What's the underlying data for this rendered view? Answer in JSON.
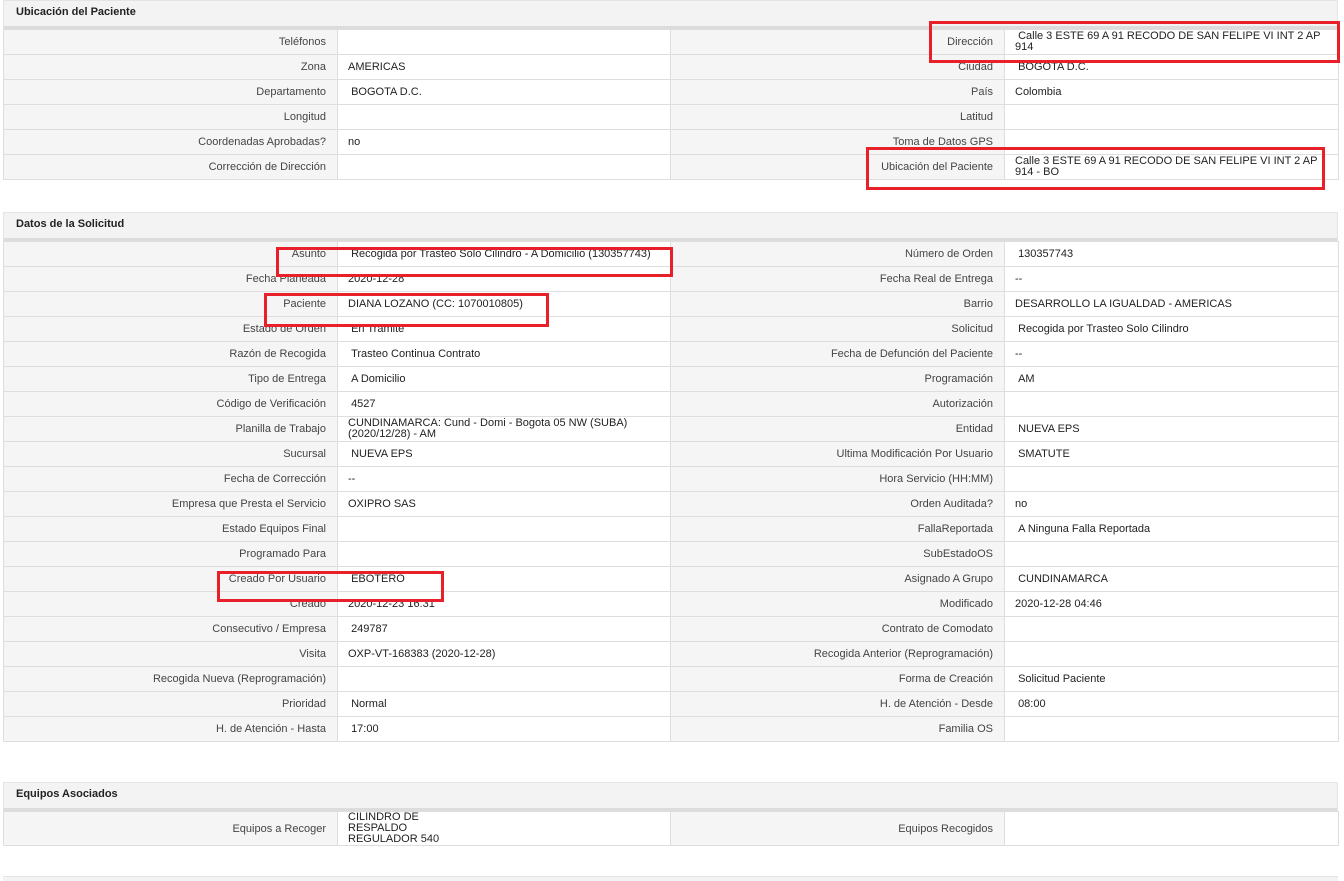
{
  "ubicacion": {
    "title": "Ubicación del Paciente",
    "rows": [
      {
        "l1": "Teléfonos",
        "v1": "",
        "l2": "Dirección",
        "v2": " Calle 3 ESTE 69 A 91 RECODO DE SAN FELIPE VI INT 2 AP 914"
      },
      {
        "l1": "Zona",
        "v1": "AMERICAS",
        "l2": "Ciudad",
        "v2": " BOGOTA D.C."
      },
      {
        "l1": "Departamento",
        "v1": " BOGOTA D.C.",
        "l2": "País",
        "v2": "Colombia"
      },
      {
        "l1": "Longitud",
        "v1": "",
        "l2": "Latitud",
        "v2": ""
      },
      {
        "l1": "Coordenadas Aprobadas?",
        "v1": "no",
        "l2": "Toma de Datos GPS",
        "v2": ""
      },
      {
        "l1": "Corrección de Dirección",
        "v1": "",
        "l2": "Ubicación del Paciente",
        "v2": "Calle 3 ESTE 69 A 91 RECODO DE SAN FELIPE VI INT 2 AP 914 - BO"
      }
    ]
  },
  "solicitud": {
    "title": "Datos de la Solicitud",
    "rows": [
      {
        "l1": "Asunto",
        "v1": " Recogida por Trasteo Solo Cilindro - A Domicilio (130357743)",
        "l2": "Número de Orden",
        "v2": " 130357743"
      },
      {
        "l1": "Fecha Planeada",
        "v1": "2020-12-28",
        "l2": "Fecha Real de Entrega",
        "v2": "--"
      },
      {
        "l1": "Paciente",
        "v1": "DIANA LOZANO (CC: 1070010805)",
        "l2": "Barrio",
        "v2": "DESARROLLO LA IGUALDAD - AMERICAS"
      },
      {
        "l1": "Estado de Orden",
        "v1": " En Tramite",
        "l2": "Solicitud",
        "v2": " Recogida por Trasteo Solo Cilindro"
      },
      {
        "l1": "Razón de Recogida",
        "v1": " Trasteo Continua Contrato",
        "l2": "Fecha de Defunción del Paciente",
        "v2": "--"
      },
      {
        "l1": "Tipo de Entrega",
        "v1": " A Domicilio",
        "l2": "Programación",
        "v2": " AM"
      },
      {
        "l1": "Código de Verificación",
        "v1": " 4527",
        "l2": "Autorización",
        "v2": ""
      },
      {
        "l1": "Planilla de Trabajo",
        "v1": "CUNDINAMARCA: Cund - Domi - Bogota 05 NW (SUBA) (2020/12/28) - AM",
        "l2": "Entidad",
        "v2": " NUEVA EPS"
      },
      {
        "l1": "Sucursal",
        "v1": " NUEVA EPS",
        "l2": "Ultima Modificación Por Usuario",
        "v2": " SMATUTE"
      },
      {
        "l1": "Fecha de Corrección",
        "v1": "--",
        "l2": "Hora Servicio (HH:MM)",
        "v2": ""
      },
      {
        "l1": "Empresa que Presta el Servicio",
        "v1": "OXIPRO SAS",
        "l2": "Orden Auditada?",
        "v2": "no"
      },
      {
        "l1": "Estado Equipos Final",
        "v1": "",
        "l2": "FallaReportada",
        "v2": " A Ninguna Falla Reportada"
      },
      {
        "l1": "Programado Para",
        "v1": "",
        "l2": "SubEstadoOS",
        "v2": ""
      },
      {
        "l1": "Creado Por Usuario",
        "v1": " EBOTERO",
        "l2": "Asignado A Grupo",
        "v2": " CUNDINAMARCA"
      },
      {
        "l1": "Creado",
        "v1": "2020-12-23 16:31",
        "l2": "Modificado",
        "v2": "2020-12-28 04:46"
      },
      {
        "l1": "Consecutivo / Empresa",
        "v1": " 249787",
        "l2": "Contrato de Comodato",
        "v2": ""
      },
      {
        "l1": "Visita",
        "v1": "OXP-VT-168383 (2020-12-28)",
        "l2": "Recogida Anterior (Reprogramación)",
        "v2": ""
      },
      {
        "l1": "Recogida Nueva (Reprogramación)",
        "v1": "",
        "l2": "Forma de Creación",
        "v2": " Solicitud Paciente"
      },
      {
        "l1": "Prioridad",
        "v1": " Normal",
        "l2": "H. de Atención - Desde",
        "v2": " 08:00"
      },
      {
        "l1": "H. de Atención - Hasta",
        "v1": " 17:00",
        "l2": "Familia OS",
        "v2": ""
      }
    ]
  },
  "equipos": {
    "title": "Equipos Asociados",
    "rows": [
      {
        "l1": "Equipos a Recoger",
        "v1": "CILINDRO DE RESPALDO REGULADOR 540",
        "l2": "Equipos Recogidos",
        "v2": ""
      }
    ]
  },
  "highlight_color": "#e8202a"
}
